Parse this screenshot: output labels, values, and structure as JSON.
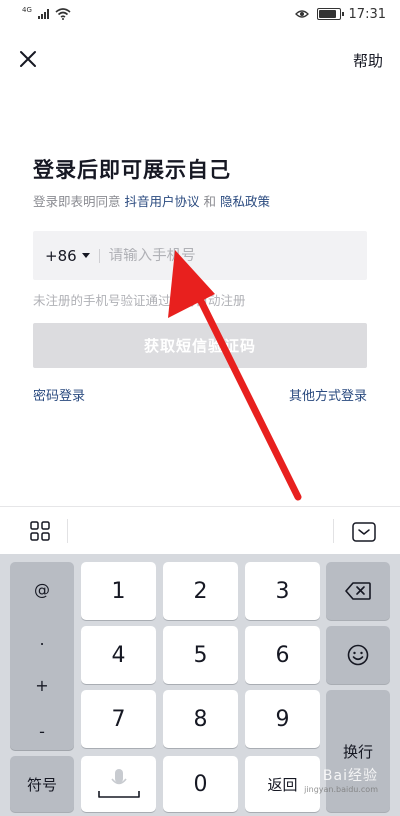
{
  "status_bar": {
    "signal_tag": "4G",
    "time": "17:31"
  },
  "header": {
    "close_icon": "close-icon",
    "help_label": "帮助"
  },
  "login": {
    "title": "登录后即可展示自己",
    "agreement_prefix": "登录即表明同意",
    "agreement_link1": "抖音用户协议",
    "agreement_and": "和",
    "agreement_link2": "隐私政策",
    "country_code": "+86",
    "phone_placeholder": "请输入手机号",
    "phone_value": "",
    "hint": "未注册的手机号验证通过后将自动注册",
    "sms_button": "获取短信验证码",
    "password_login": "密码登录",
    "other_login": "其他方式登录"
  },
  "keyboard": {
    "symbols": [
      "@",
      ".",
      "+",
      "-"
    ],
    "digits": [
      "1",
      "2",
      "3",
      "4",
      "5",
      "6",
      "7",
      "8",
      "9",
      "0"
    ],
    "symbol_key": "符号",
    "return_key": "返回",
    "newline_key": "换行"
  },
  "watermark": {
    "main": "Bai经验",
    "sub": "jingyan.baidu.com"
  },
  "colors": {
    "link": "#2a4a7f",
    "disabled_button": "#dcdcdf",
    "keyboard_bg": "#d6d9de",
    "arrow": "#e8201e"
  }
}
